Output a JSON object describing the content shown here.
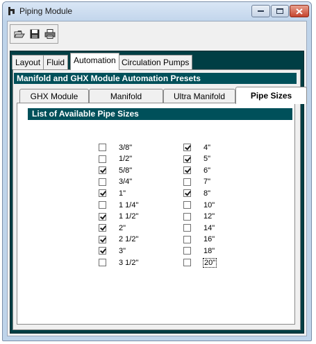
{
  "window": {
    "title": "Piping Module"
  },
  "toolbar": {
    "icons": [
      "open-folder-icon",
      "save-disk-icon",
      "print-icon"
    ]
  },
  "main_tabs": [
    {
      "label": "Layout",
      "active": false
    },
    {
      "label": "Fluid",
      "active": false
    },
    {
      "label": "Automation",
      "active": true
    },
    {
      "label": "Circulation Pumps",
      "active": false
    }
  ],
  "section": {
    "title": "Manifold and GHX Module Automation Presets"
  },
  "sub_tabs": [
    {
      "label": "GHX Module",
      "active": false
    },
    {
      "label": "Manifold",
      "active": false
    },
    {
      "label": "Ultra Manifold",
      "active": false
    },
    {
      "label": "Pipe Sizes",
      "active": true
    }
  ],
  "pipe_sizes": {
    "title": "List of Available Pipe Sizes",
    "left_column": [
      {
        "label": "3/8\"",
        "checked": false
      },
      {
        "label": "1/2\"",
        "checked": false
      },
      {
        "label": "5/8\"",
        "checked": true
      },
      {
        "label": "3/4\"",
        "checked": false
      },
      {
        "label": "1\"",
        "checked": true
      },
      {
        "label": "1 1/4\"",
        "checked": false
      },
      {
        "label": "1 1/2\"",
        "checked": true
      },
      {
        "label": "2\"",
        "checked": true
      },
      {
        "label": "2 1/2\"",
        "checked": true
      },
      {
        "label": "3\"",
        "checked": true
      },
      {
        "label": "3 1/2\"",
        "checked": false
      }
    ],
    "right_column": [
      {
        "label": "4\"",
        "checked": true
      },
      {
        "label": "5\"",
        "checked": true
      },
      {
        "label": "6\"",
        "checked": true
      },
      {
        "label": "7\"",
        "checked": false
      },
      {
        "label": "8\"",
        "checked": true
      },
      {
        "label": "10\"",
        "checked": false
      },
      {
        "label": "12\"",
        "checked": false
      },
      {
        "label": "14\"",
        "checked": false
      },
      {
        "label": "16\"",
        "checked": false
      },
      {
        "label": "18\"",
        "checked": false
      },
      {
        "label": "20\"",
        "checked": false,
        "focused": true
      }
    ]
  },
  "colors": {
    "header_bar": "#00505a",
    "dark_panel": "#003e44",
    "window_frame": "#bfd4ea"
  }
}
